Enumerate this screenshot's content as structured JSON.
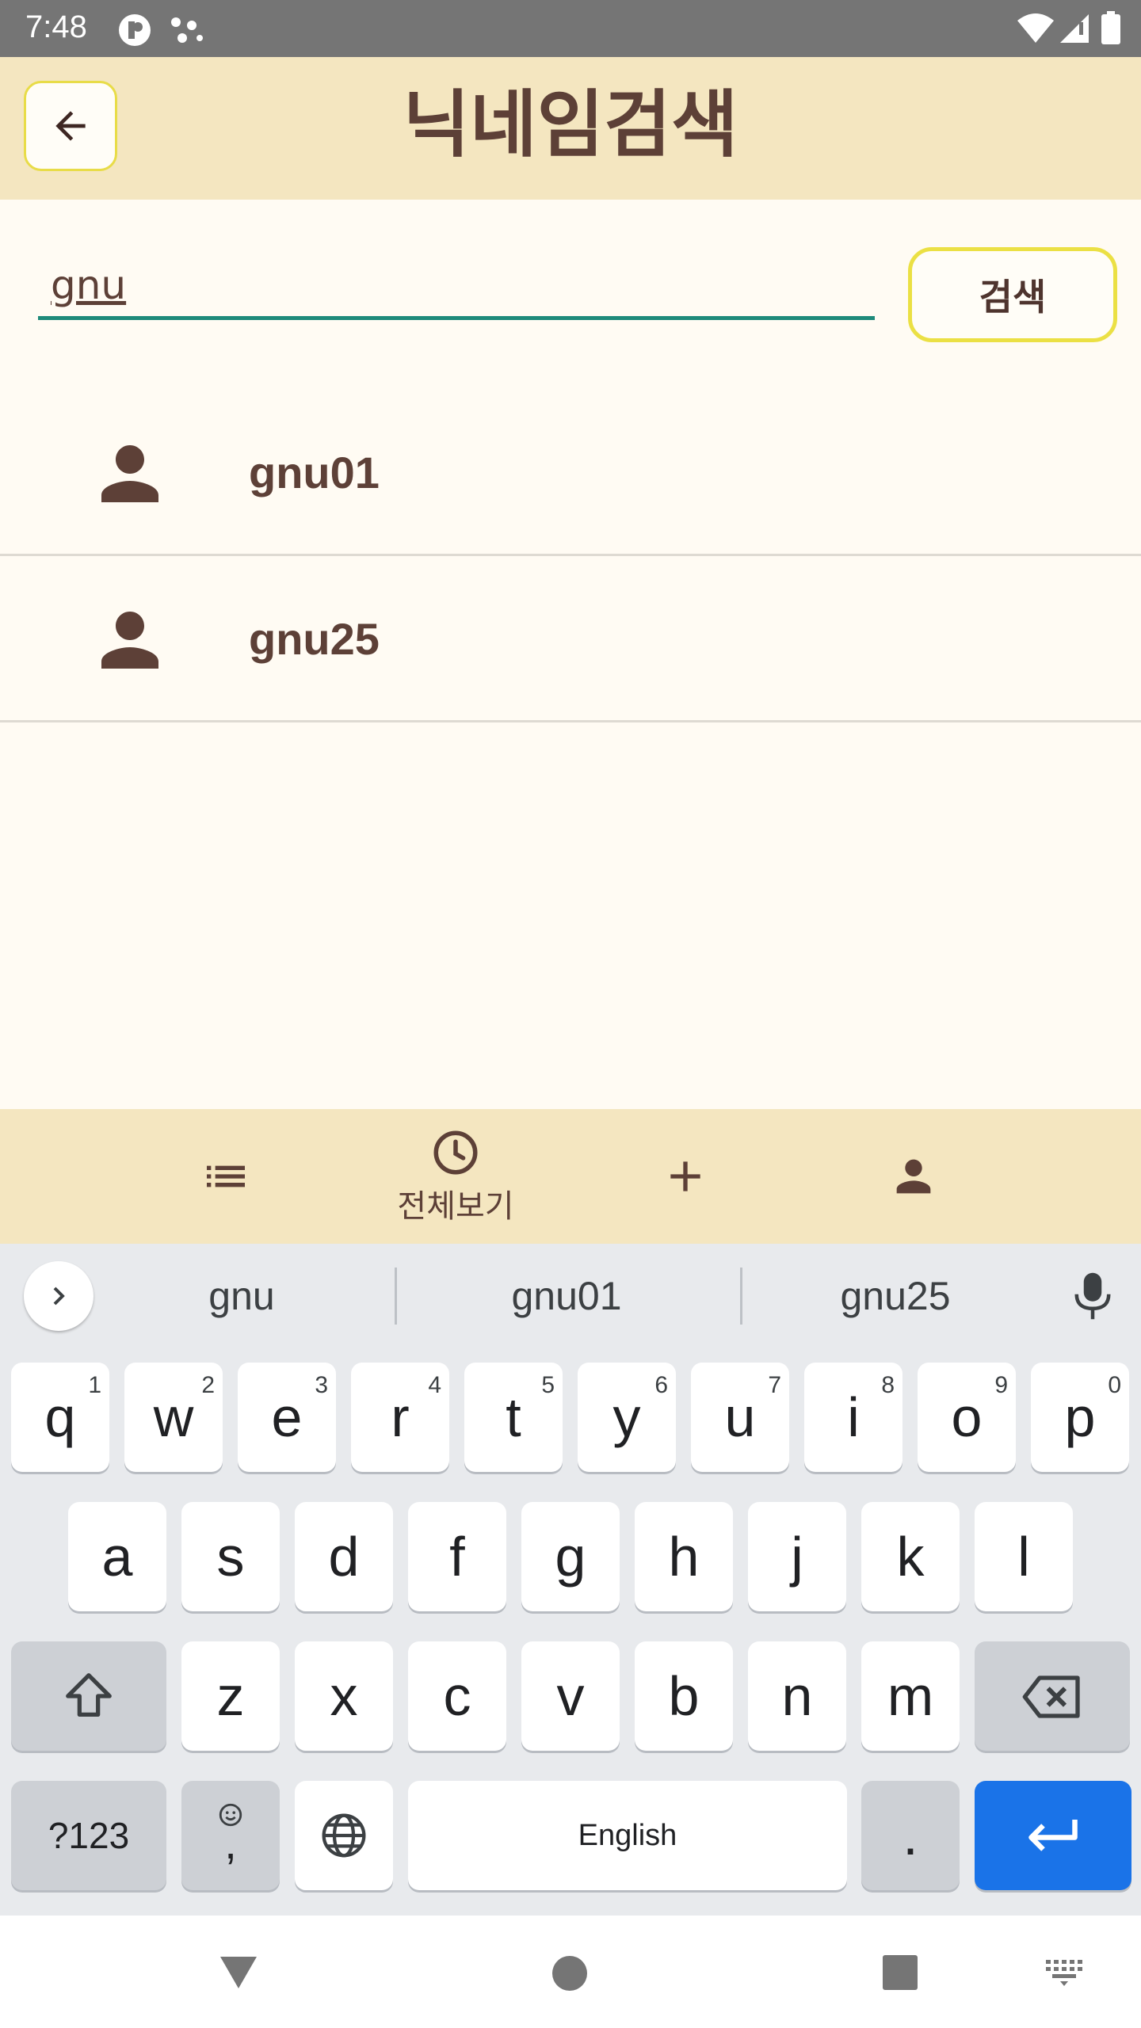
{
  "status_bar": {
    "time": "7:48",
    "icons": [
      "notification-app-icon",
      "dots-icon",
      "wifi-icon",
      "signal-icon",
      "battery-icon"
    ]
  },
  "app_bar": {
    "back_icon": "arrow-left-icon",
    "title": "닉네임검색"
  },
  "search": {
    "value": "gnu",
    "button_label": "검색"
  },
  "results": [
    {
      "icon": "person-icon",
      "name": "gnu01"
    },
    {
      "icon": "person-icon",
      "name": "gnu25"
    }
  ],
  "bottom_nav": {
    "items": [
      {
        "icon": "list-icon",
        "label": ""
      },
      {
        "icon": "clock-icon",
        "label": "전체보기"
      },
      {
        "icon": "plus-icon",
        "label": ""
      },
      {
        "icon": "person-icon",
        "label": ""
      }
    ]
  },
  "keyboard": {
    "suggestions": [
      "gnu",
      "gnu01",
      "gnu25"
    ],
    "row1": [
      {
        "key": "q",
        "hint": "1"
      },
      {
        "key": "w",
        "hint": "2"
      },
      {
        "key": "e",
        "hint": "3"
      },
      {
        "key": "r",
        "hint": "4"
      },
      {
        "key": "t",
        "hint": "5"
      },
      {
        "key": "y",
        "hint": "6"
      },
      {
        "key": "u",
        "hint": "7"
      },
      {
        "key": "i",
        "hint": "8"
      },
      {
        "key": "o",
        "hint": "9"
      },
      {
        "key": "p",
        "hint": "0"
      }
    ],
    "row2": [
      "a",
      "s",
      "d",
      "f",
      "g",
      "h",
      "j",
      "k",
      "l"
    ],
    "row3": [
      "z",
      "x",
      "c",
      "v",
      "b",
      "n",
      "m"
    ],
    "symbols_label": "?123",
    "comma_label": ",",
    "space_label": "English",
    "period_label": ".",
    "accent_color": "#1a73e8"
  },
  "system_nav": {
    "icons": [
      "back-triangle-icon",
      "home-circle-icon",
      "recents-square-icon",
      "keyboard-switch-icon"
    ]
  },
  "colors": {
    "app_bar": "#f4e6c0",
    "text_brown": "#5d4037",
    "accent_teal": "#1e8a7a",
    "button_border": "#ebe044"
  }
}
